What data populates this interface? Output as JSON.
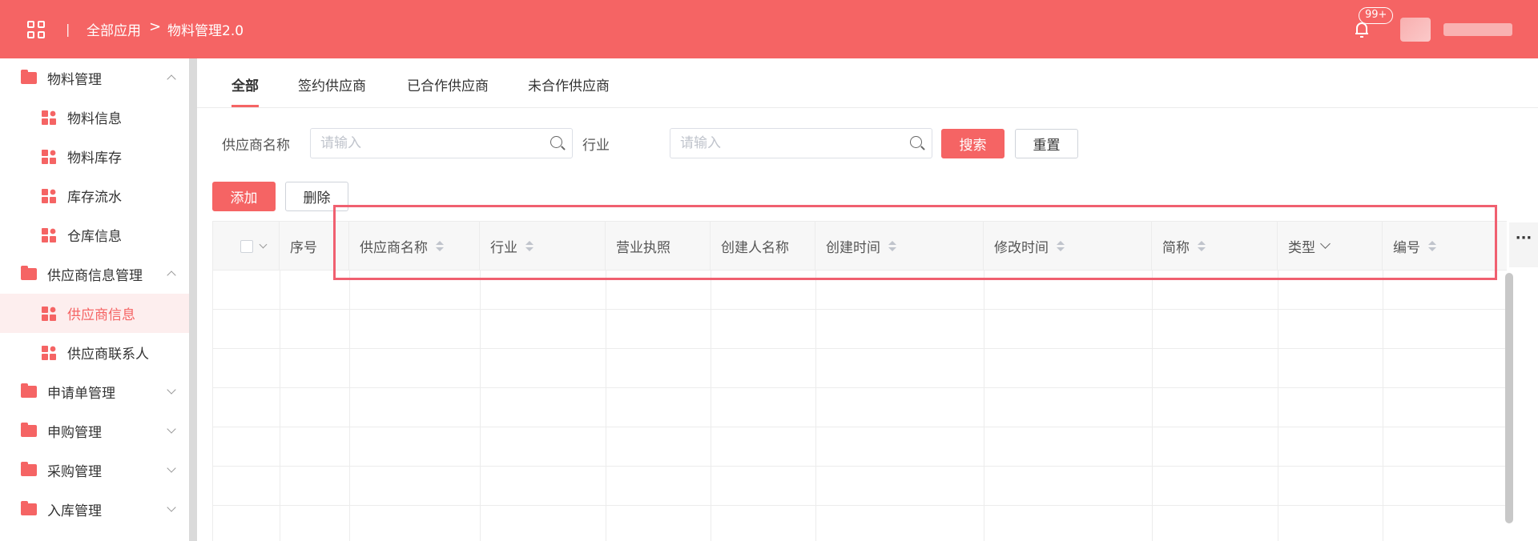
{
  "header": {
    "separator": "|",
    "breadcrumb": [
      "全部应用",
      "物料管理2.0"
    ],
    "arrow": ">",
    "badge": "99+"
  },
  "sidebar": {
    "items": [
      {
        "label": "物料管理",
        "type": "group",
        "expanded": true
      },
      {
        "label": "物料信息",
        "type": "sub"
      },
      {
        "label": "物料库存",
        "type": "sub"
      },
      {
        "label": "库存流水",
        "type": "sub"
      },
      {
        "label": "仓库信息",
        "type": "sub"
      },
      {
        "label": "供应商信息管理",
        "type": "group",
        "expanded": true
      },
      {
        "label": "供应商信息",
        "type": "sub",
        "active": true
      },
      {
        "label": "供应商联系人",
        "type": "sub"
      },
      {
        "label": "申请单管理",
        "type": "group",
        "expanded": false
      },
      {
        "label": "申购管理",
        "type": "group",
        "expanded": false
      },
      {
        "label": "采购管理",
        "type": "group",
        "expanded": false
      },
      {
        "label": "入库管理",
        "type": "group",
        "expanded": false
      }
    ]
  },
  "tabs": [
    "全部",
    "签约供应商",
    "已合作供应商",
    "未合作供应商"
  ],
  "filters": {
    "supplier_label": "供应商名称",
    "supplier_placeholder": "请输入",
    "industry_label": "行业",
    "industry_placeholder": "请输入",
    "search_button": "搜索",
    "reset_button": "重置"
  },
  "actions": {
    "add": "添加",
    "delete": "删除"
  },
  "table": {
    "columns": [
      "",
      "序号",
      "供应商名称",
      "行业",
      "营业执照",
      "创建人名称",
      "创建时间",
      "修改时间",
      "简称",
      "类型",
      "编号"
    ],
    "more": "···"
  },
  "colors": {
    "accent": "#f56464",
    "highlight": "#f06070"
  }
}
